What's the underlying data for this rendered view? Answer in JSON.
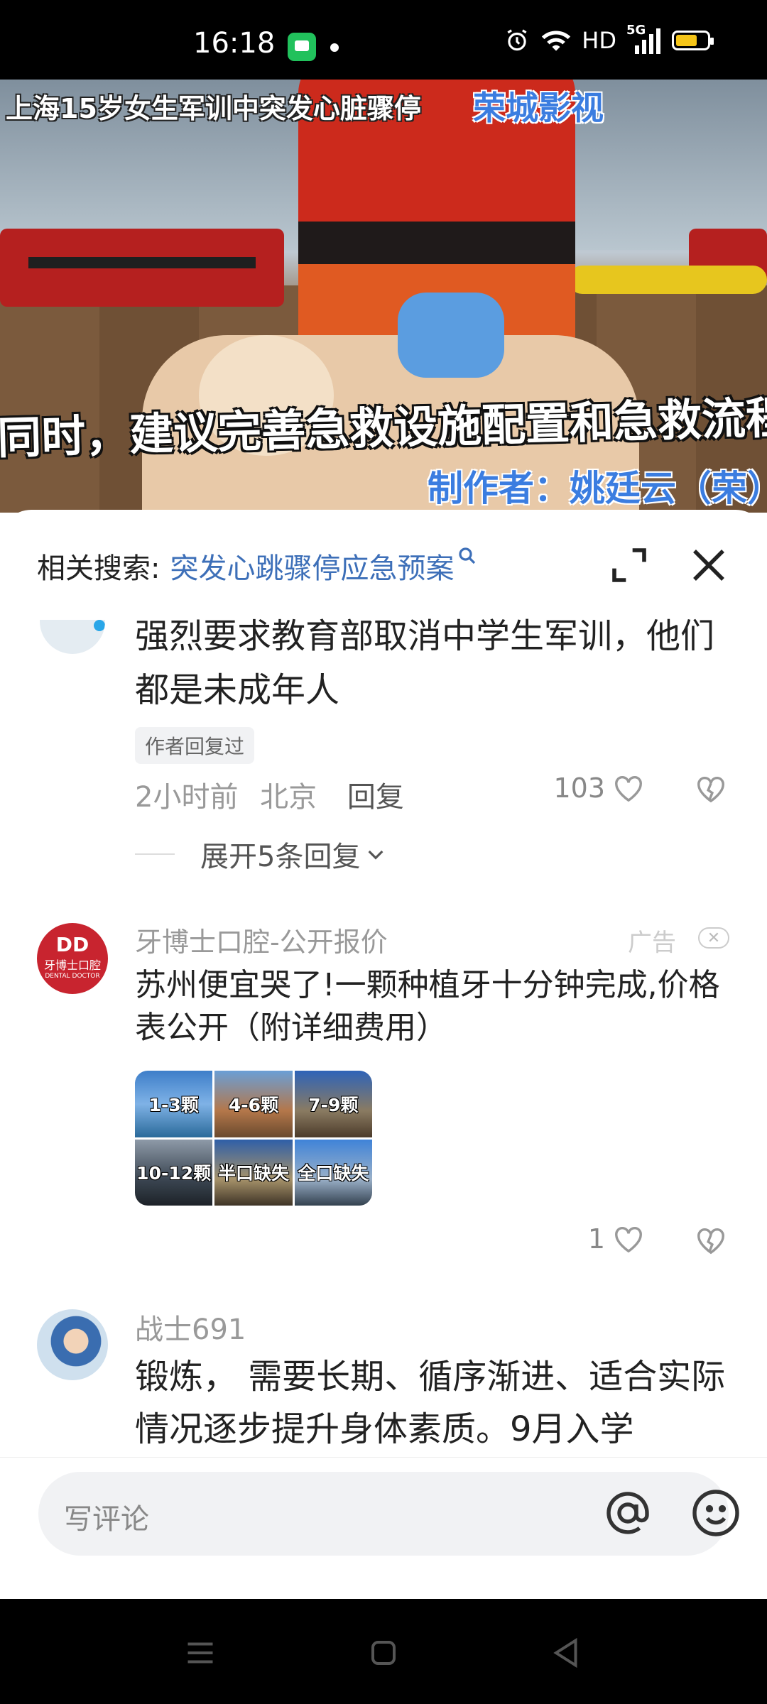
{
  "status_bar": {
    "time": "16:18",
    "network": "HD",
    "signal_label": "5G",
    "icons": [
      "message-app-icon",
      "alarm-icon",
      "wifi-icon",
      "signal-icon",
      "battery-icon"
    ],
    "battery_color": "#f5c518"
  },
  "video": {
    "caption_top": "上海15岁女生军训中突发心脏骤停",
    "brand": "荣城影视",
    "caption_main": "同时，建议完善急救设施配置和急救流程",
    "author": "制作者：姚廷云（荣）"
  },
  "related_search": {
    "label": "相关搜索:",
    "query": "突发心跳骤停应急预案",
    "link_color": "#3d6fb8"
  },
  "comments": [
    {
      "text": "强烈要求教育部取消中学生军训，他们都是未成年人",
      "badge": "作者回复过",
      "time": "2小时前",
      "location": "北京",
      "reply_label": "回复",
      "likes": "103",
      "expand_label": "展开5条回复"
    },
    {
      "name": "战士691",
      "text": "锻炼， 需要长期、循序渐进、适合实际情况逐步提升身体素质。9月入学"
    }
  ],
  "ad": {
    "logo_mark": "DD",
    "logo_cn": "牙博士口腔",
    "logo_en": "DENTAL DOCTOR",
    "name": "牙博士口腔-公开报价",
    "tag": "广告",
    "close_glyph": "✕",
    "text": "苏州便宜哭了!一颗种植牙十分钟完成,价格表公开（附详细费用）",
    "tiles": [
      "1-3颗",
      "4-6颗",
      "7-9颗",
      "10-12颗",
      "半口缺失",
      "全口缺失"
    ],
    "likes": "1",
    "brand_color": "#c8242f"
  },
  "input": {
    "placeholder": "写评论"
  }
}
